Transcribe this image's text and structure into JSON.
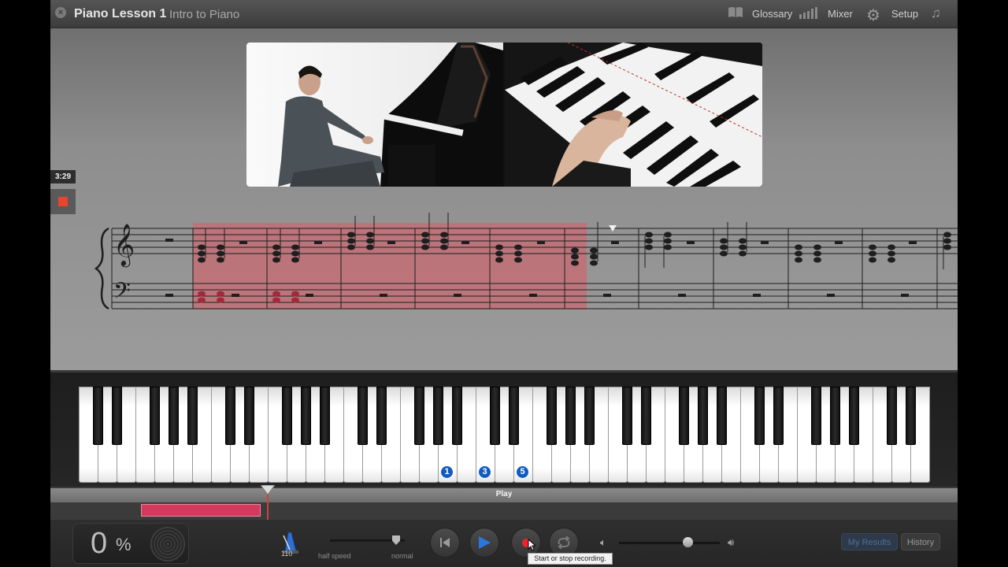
{
  "window": {
    "title": "Piano Lesson 1",
    "subtitle": "Intro to Piano"
  },
  "toolbar": {
    "glossary_label": "Glossary",
    "mixer_label": "Mixer",
    "setup_label": "Setup"
  },
  "lesson": {
    "elapsed_time": "3:29"
  },
  "keyboard": {
    "finger_numbers": [
      "1",
      "3",
      "5"
    ]
  },
  "timeline": {
    "label": "Play"
  },
  "transport": {
    "score_value": "0",
    "score_unit": "%",
    "tempo": "110",
    "speed_min_label": "half speed",
    "speed_max_label": "normal",
    "record_tooltip": "Start or stop recording.",
    "my_results_label": "My Results",
    "history_label": "History"
  },
  "colors": {
    "accent_blue": "#2a77e0",
    "record_red": "#e8262c",
    "played_region": "#d33a5e",
    "finger_marker": "#0f5bbf"
  }
}
